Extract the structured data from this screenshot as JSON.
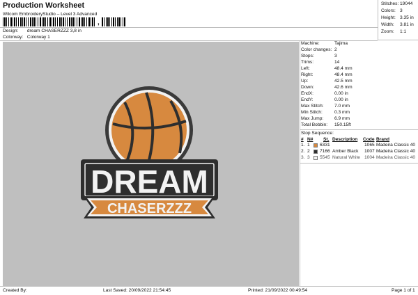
{
  "header": {
    "title": "Production Worksheet",
    "subtitle": "Wilcom EmbroideryStudio – Level 3 Advanced",
    "barcode_separator": ",",
    "design_label": "Design:",
    "design_value": "dream CHASERZZZ  3,8 in",
    "colorway_label": "Colorway:",
    "colorway_value": "Colorway 1"
  },
  "stats": [
    {
      "label": "Stitches:",
      "value": "19044"
    },
    {
      "label": "Colors:",
      "value": "3"
    },
    {
      "label": "Height:",
      "value": "3.35 in"
    },
    {
      "label": "Width:",
      "value": "3.81 in"
    },
    {
      "label": "Zoom:",
      "value": "1:1"
    }
  ],
  "design": {
    "top_text": "DREAM",
    "bottom_text": "CHASERZZZ"
  },
  "machine_info": [
    {
      "label": "Machine:",
      "value": "Tajima"
    },
    {
      "label": "Color changes:",
      "value": "2"
    },
    {
      "label": "Stops:",
      "value": "3"
    },
    {
      "label": "Trims:",
      "value": "14"
    },
    {
      "label": "Left:",
      "value": "48.4 mm"
    },
    {
      "label": "Right:",
      "value": "48.4 mm"
    },
    {
      "label": "Up:",
      "value": "42.5 mm"
    },
    {
      "label": "Down:",
      "value": "42.6 mm"
    },
    {
      "label": "EndX:",
      "value": "0.00 in"
    },
    {
      "label": "EndY:",
      "value": "0.00 in"
    },
    {
      "label": "Max Stitch:",
      "value": "7.0 mm"
    },
    {
      "label": "Min Stitch:",
      "value": "0.3 mm"
    },
    {
      "label": "Max Jump:",
      "value": "6.9 mm"
    },
    {
      "label": "Total Bobbin:",
      "value": "150.15ft"
    }
  ],
  "stop_sequence": {
    "heading": "Stop Sequence:",
    "columns": {
      "num": "#",
      "n": "N#",
      "st": "St.",
      "description": "Description",
      "code": "Code",
      "brand": "Brand"
    },
    "rows": [
      {
        "num": "1.",
        "n": "1",
        "color": "#d7893f",
        "st": "6331",
        "description": "",
        "code": "1065",
        "brand": "Madeira Classic 40"
      },
      {
        "num": "2.",
        "n": "2",
        "color": "#2e2e2e",
        "st": "7166",
        "description": "Amber Black",
        "code": "1007",
        "brand": "Madeira Classic 40"
      },
      {
        "num": "3.",
        "n": "3",
        "color": "#f2f2f2",
        "st": "5545",
        "description": "Natural White",
        "code": "1004",
        "brand": "Madeira Classic 40"
      }
    ]
  },
  "footer": {
    "created_by": "Created By:",
    "last_saved": "Last Saved: 20/09/2022 21:54:45",
    "printed": "Printed: 21/09/2022 00:49:54",
    "page": "Page 1 of 1"
  }
}
